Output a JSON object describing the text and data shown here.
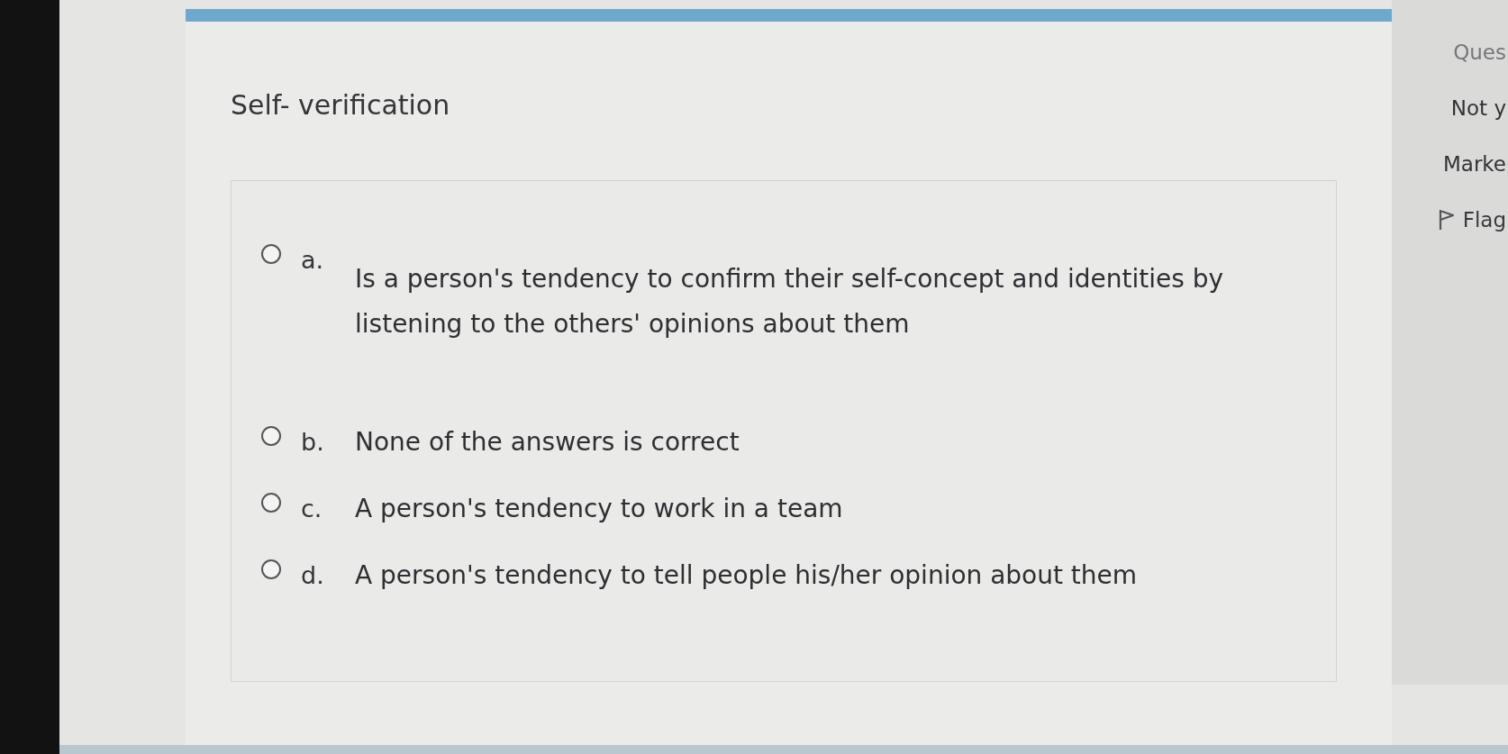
{
  "question": {
    "title": "Self- verification",
    "options": [
      {
        "letter": "a.",
        "text": "Is a person's tendency to confirm their self-concept and identities by listening to the others' opinions about them",
        "kind": "paragraph",
        "selected": false
      },
      {
        "letter": "b.",
        "text": "None of the answers is correct",
        "kind": "line",
        "selected": false
      },
      {
        "letter": "c.",
        "text": "A person's tendency to work in a team",
        "kind": "line",
        "selected": false
      },
      {
        "letter": "d.",
        "text": "A person's tendency to tell people his/her opinion about them",
        "kind": "line",
        "selected": false
      }
    ]
  },
  "sidebar": {
    "items": [
      {
        "kind": "heading",
        "text": "Ques"
      },
      {
        "kind": "status",
        "text": "Not y"
      },
      {
        "kind": "marks",
        "text": "Marke"
      },
      {
        "kind": "flag",
        "text": "Flag"
      }
    ]
  }
}
